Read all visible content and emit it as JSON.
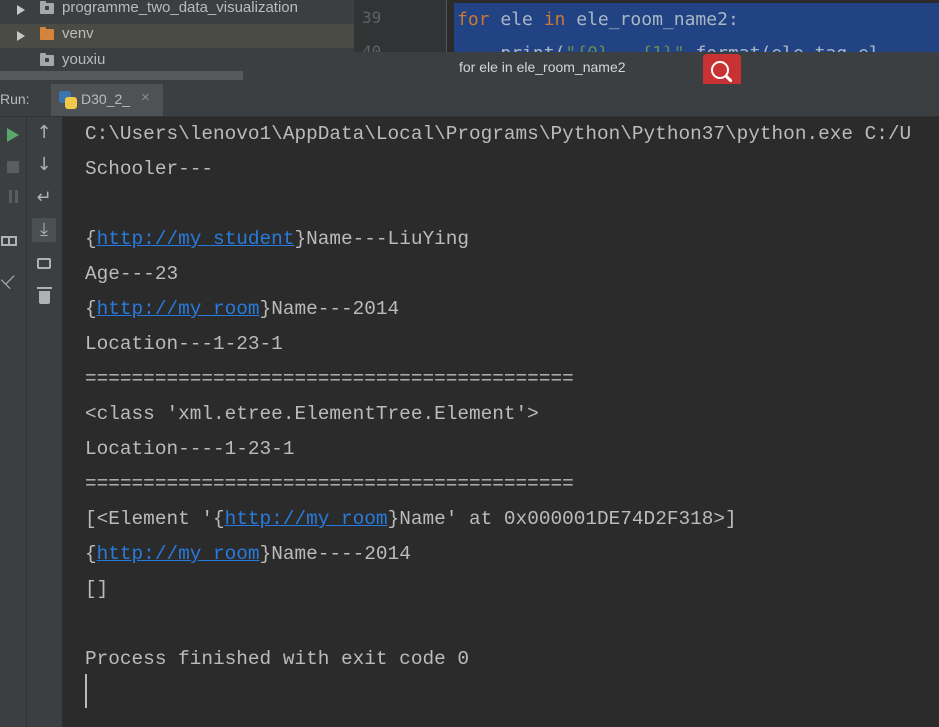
{
  "project_tree": {
    "items": [
      {
        "label": "programme_two_data_visualization",
        "folder_color": "gray"
      },
      {
        "label": "venv",
        "folder_color": "orange"
      },
      {
        "label": "youxiu",
        "folder_color": "gray"
      }
    ]
  },
  "editor": {
    "line_numbers": [
      "39",
      "40"
    ],
    "line1": {
      "kw1": "for",
      "var1": " ele ",
      "kw2": "in",
      "rest": " ele_room_name2:"
    },
    "line2": {
      "indent": "    ",
      "fn": "print(",
      "str1": "\"{0}---{1}\"",
      "rest": ".format(ele.tag,el"
    }
  },
  "find_bar": {
    "query": "for ele in ele_room_name2",
    "colors": {
      "button": "#c83232"
    }
  },
  "run_panel": {
    "label": "Run:",
    "tab_label": "D30_2_",
    "tab_close": "×"
  },
  "console": {
    "lines": [
      {
        "text": "C:\\Users\\lenovo1\\AppData\\Local\\Programs\\Python\\Python37\\python.exe C:/U"
      },
      {
        "text": "Schooler---"
      },
      {
        "text": ""
      },
      {
        "pre": "{",
        "link": "http://my_student",
        "post": "}Name---LiuYing"
      },
      {
        "text": "Age---23"
      },
      {
        "pre": "{",
        "link": "http://my_room",
        "post": "}Name---2014"
      },
      {
        "text": "Location---1-23-1"
      },
      {
        "text": "=========================================="
      },
      {
        "text": "<class 'xml.etree.ElementTree.Element'>"
      },
      {
        "text": "Location----1-23-1"
      },
      {
        "text": "=========================================="
      },
      {
        "pre": "[<Element '{",
        "link": "http://my_room",
        "post": "}Name' at 0x000001DE74D2F318>]"
      },
      {
        "pre": "{",
        "link": "http://my_room",
        "post": "}Name----2014"
      },
      {
        "text": "[]"
      },
      {
        "text": ""
      },
      {
        "text": "Process finished with exit code 0"
      }
    ],
    "colors": {
      "text": "#bbbbbb",
      "link": "#287bde",
      "background": "#2b2b2b"
    }
  },
  "toolbar_icons": [
    "up-arrow-icon",
    "down-arrow-icon",
    "soft-wrap-icon",
    "scroll-to-end-icon",
    "print-icon",
    "trash-icon"
  ],
  "left_icons": [
    "run-icon",
    "stop-icon",
    "pause-icon",
    "layout-icon",
    "pin-icon"
  ]
}
